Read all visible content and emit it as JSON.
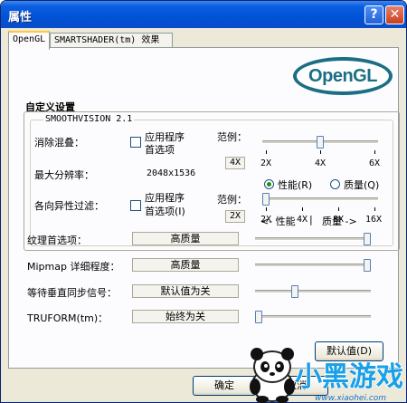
{
  "window": {
    "title": "属性",
    "help": "?",
    "close": "✕"
  },
  "tabs": [
    {
      "label": "OpenGL",
      "active": true
    },
    {
      "label": "SMARTSHADER(tm) 效果",
      "active": false
    }
  ],
  "logo": {
    "text": "OpenGL"
  },
  "custom": {
    "title": "自定义设置",
    "smooth_title": "SMOOTHVISION 2.1",
    "aa_label": "消除混叠：",
    "aa_app_line1": "应用程序",
    "aa_app_line2": "首选项",
    "aa_range_label": "范例：",
    "aa_value": "4X",
    "aa_ticks": [
      "2X",
      "4X",
      "6X"
    ],
    "aa_level": 0.5,
    "maxres_label": "最大分辨率：",
    "maxres_value": "2048x1536",
    "af_label": "各向异性过滤：",
    "af_app_line1": "应用程序",
    "af_app_line2": "首选项(I)",
    "af_range_label": "范例：",
    "af_value": "2X",
    "af_ticks": [
      "2X",
      "4X",
      "8X",
      "16X"
    ],
    "af_level": 0.0,
    "radio_perf": "性能(R)",
    "radio_quality": "质量(Q)"
  },
  "perf_quality": {
    "perf": "<- 性能",
    "sep": "|",
    "quality": "质量 ->"
  },
  "settings": [
    {
      "label": "纹理首选项：",
      "value": "高质量",
      "level": 1.0
    },
    {
      "label": "Mipmap 详细程度：",
      "value": "高质量",
      "level": 1.0
    },
    {
      "label": "等待垂直同步信号：",
      "value": "默认值为关",
      "level": 0.33
    },
    {
      "label": "TRUFORM(tm)：",
      "value": "始终为关",
      "level": 0.0
    }
  ],
  "buttons": {
    "defaults": "默认值(D)",
    "ok": "确定",
    "cancel": "取消"
  },
  "watermark": {
    "text": "小黑游戏",
    "url": "www.xiaohei.com"
  }
}
